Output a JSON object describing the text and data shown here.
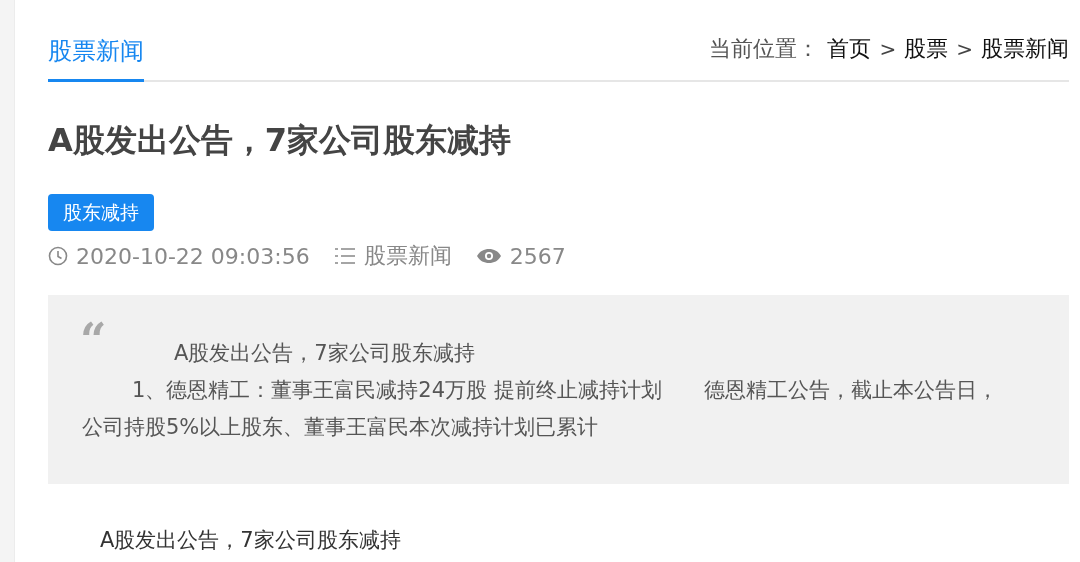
{
  "tabs": [
    {
      "label": "股票新闻",
      "selected": true
    }
  ],
  "breadcrumb": {
    "label": "当前位置：",
    "items": [
      {
        "text": "首页"
      },
      {
        "text": "股票"
      },
      {
        "text": "股票新闻"
      }
    ],
    "separator": ">"
  },
  "article": {
    "title": "A股发出公告，7家公司股东减持",
    "tags": [
      "股东减持"
    ],
    "meta": {
      "time": "2020-10-22 09:03:56",
      "category": "股票新闻",
      "views": "2567"
    },
    "summary": {
      "quote_mark": "“",
      "lines": [
        "A股发出公告，7家公司股东减持",
        "1、德恩精工：董事王富民减持24万股 提前终止减持计划　　德恩精工公告，截止本公告日，公司持股5%以上股东、董事王富民本次减持计划已累计"
      ]
    },
    "body": [
      "A股发出公告，7家公司股东减持"
    ]
  }
}
